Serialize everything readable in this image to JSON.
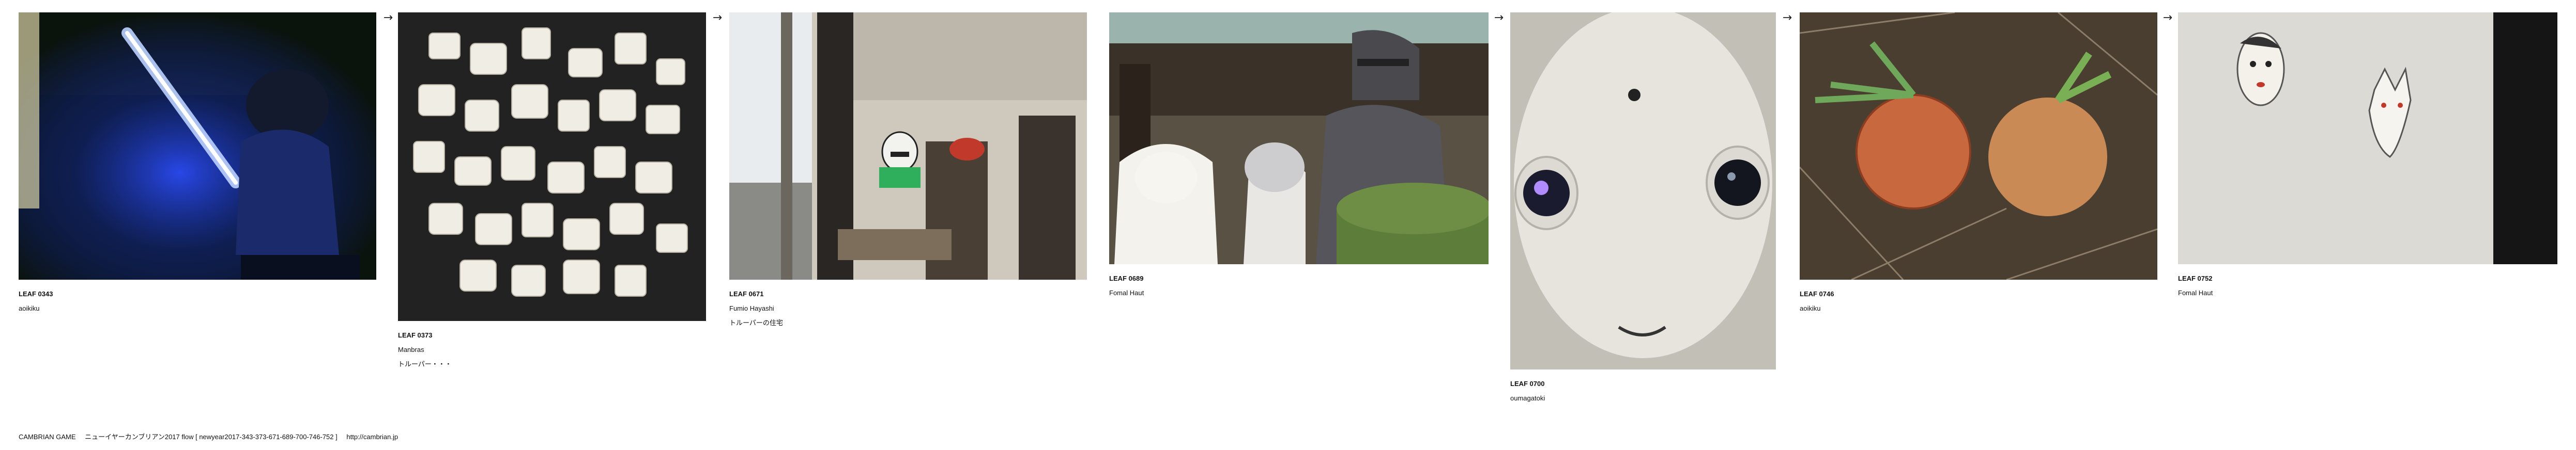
{
  "arrow_glyph": "→",
  "leaves": [
    {
      "id": "LEAF 0343",
      "author": "aoikiku",
      "note": ""
    },
    {
      "id": "LEAF 0373",
      "author": "Manbras",
      "note": "トルーパー・・・"
    },
    {
      "id": "LEAF 0671",
      "author": "Fumio Hayashi",
      "note": "トルーパーの住宅"
    },
    {
      "id": "LEAF 0689",
      "author": "Fomal Haut",
      "note": ""
    },
    {
      "id": "LEAF 0700",
      "author": "oumagatoki",
      "note": ""
    },
    {
      "id": "LEAF 0746",
      "author": "aoikiku",
      "note": ""
    },
    {
      "id": "LEAF 0752",
      "author": "Fomal Haut",
      "note": ""
    }
  ],
  "footer": {
    "brand": "CAMBRIAN GAME",
    "flow": "ニューイヤーカンブリアン2017  flow [ newyear2017-343-373-671-689-700-746-752 ]",
    "url": "http://cambrian.jp"
  }
}
